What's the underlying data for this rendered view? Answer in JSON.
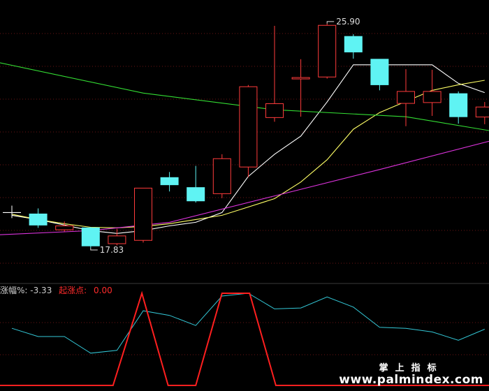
{
  "chart_data": {
    "type": "candlestick",
    "price_axis": {
      "min": 17.0,
      "max": 26.5
    },
    "annotations": {
      "high_label": "25.90",
      "low_label": "17.83"
    },
    "candles": [
      {
        "open": 19.1,
        "close": 19.1,
        "high": 19.35,
        "low": 18.9,
        "dir": "flat"
      },
      {
        "open": 19.05,
        "close": 18.65,
        "high": 19.25,
        "low": 18.55,
        "dir": "down"
      },
      {
        "open": 18.48,
        "close": 18.62,
        "high": 18.78,
        "low": 18.42,
        "dir": "up"
      },
      {
        "open": 18.55,
        "close": 17.9,
        "high": 18.58,
        "low": 17.83,
        "dir": "down"
      },
      {
        "open": 17.98,
        "close": 18.26,
        "high": 18.52,
        "low": 17.92,
        "dir": "up"
      },
      {
        "open": 18.1,
        "close": 19.98,
        "high": 19.98,
        "low": 18.02,
        "dir": "up"
      },
      {
        "open": 20.36,
        "close": 20.1,
        "high": 20.56,
        "low": 19.86,
        "dir": "down"
      },
      {
        "open": 20.0,
        "close": 19.52,
        "high": 20.78,
        "low": 19.46,
        "dir": "down"
      },
      {
        "open": 19.78,
        "close": 21.04,
        "high": 21.2,
        "low": 19.62,
        "dir": "up"
      },
      {
        "open": 20.74,
        "close": 23.63,
        "high": 23.69,
        "low": 20.37,
        "dir": "up"
      },
      {
        "open": 22.52,
        "close": 23.02,
        "high": 25.82,
        "low": 22.37,
        "dir": "up"
      },
      {
        "open": 23.96,
        "close": 23.96,
        "high": 24.62,
        "low": 22.55,
        "dir": "up"
      },
      {
        "open": 23.98,
        "close": 25.84,
        "high": 25.9,
        "low": 23.92,
        "dir": "up"
      },
      {
        "open": 25.44,
        "close": 24.88,
        "high": 25.52,
        "low": 24.64,
        "dir": "down"
      },
      {
        "open": 24.62,
        "close": 23.7,
        "high": 24.62,
        "low": 23.5,
        "dir": "down"
      },
      {
        "open": 23.03,
        "close": 23.46,
        "high": 24.26,
        "low": 22.21,
        "dir": "up"
      },
      {
        "open": 23.06,
        "close": 23.46,
        "high": 24.24,
        "low": 22.58,
        "dir": "up"
      },
      {
        "open": 23.38,
        "close": 22.55,
        "high": 23.46,
        "low": 22.3,
        "dir": "down"
      },
      {
        "open": 22.54,
        "close": 22.9,
        "high": 23.08,
        "low": 22.28,
        "dir": "up"
      }
    ],
    "ma_lines": [
      {
        "color": "#ffffff",
        "points": [
          [
            0,
            19.0
          ],
          [
            1,
            18.85
          ],
          [
            2,
            18.65
          ],
          [
            3,
            18.45
          ],
          [
            4,
            18.35
          ],
          [
            5,
            18.45
          ],
          [
            6,
            18.62
          ],
          [
            7,
            18.75
          ],
          [
            8,
            19.1
          ],
          [
            9,
            20.4
          ],
          [
            10,
            21.2
          ],
          [
            11,
            21.85
          ],
          [
            12,
            23.08
          ],
          [
            13,
            24.42
          ],
          [
            14,
            24.42
          ],
          [
            15,
            24.42
          ],
          [
            16,
            24.42
          ],
          [
            17,
            23.75
          ],
          [
            18,
            23.42
          ]
        ]
      },
      {
        "color": "#ffff66",
        "points": [
          [
            0,
            19.04
          ],
          [
            1,
            18.85
          ],
          [
            2,
            18.7
          ],
          [
            3,
            18.57
          ],
          [
            4,
            18.55
          ],
          [
            5,
            18.6
          ],
          [
            6,
            18.7
          ],
          [
            7,
            18.85
          ],
          [
            8,
            19.0
          ],
          [
            9,
            19.3
          ],
          [
            10,
            19.6
          ],
          [
            11,
            20.2
          ],
          [
            12,
            21.0
          ],
          [
            13,
            22.1
          ],
          [
            14,
            22.7
          ],
          [
            15,
            23.1
          ],
          [
            16,
            23.5
          ],
          [
            17,
            23.7
          ],
          [
            18,
            23.86
          ]
        ]
      },
      {
        "color": "#33dd33",
        "points": [
          [
            -0.5,
            24.5
          ],
          [
            5,
            23.4
          ],
          [
            10,
            22.8
          ],
          [
            15,
            22.55
          ],
          [
            18.5,
            22.0
          ]
        ]
      },
      {
        "color": "#dd33dd",
        "points": [
          [
            -0.5,
            18.3
          ],
          [
            3,
            18.45
          ],
          [
            6,
            18.75
          ],
          [
            10,
            19.7
          ],
          [
            14,
            20.65
          ],
          [
            18.5,
            21.75
          ]
        ]
      }
    ],
    "indicator": {
      "legend_label": "涨幅%:",
      "legend_value": "-3.33",
      "signal_label": "起涨点:",
      "signal_value": "0.00",
      "range": [
        0,
        1
      ],
      "cyan": [
        [
          0,
          0.62
        ],
        [
          1,
          0.53
        ],
        [
          2,
          0.53
        ],
        [
          3,
          0.35
        ],
        [
          4,
          0.38
        ],
        [
          5,
          0.81
        ],
        [
          6,
          0.76
        ],
        [
          7,
          0.65
        ],
        [
          8,
          0.97
        ],
        [
          9,
          1.0
        ],
        [
          10,
          0.83
        ],
        [
          11,
          0.84
        ],
        [
          12,
          0.96
        ],
        [
          13,
          0.85
        ],
        [
          14,
          0.63
        ],
        [
          15,
          0.62
        ],
        [
          16,
          0.58
        ],
        [
          17,
          0.49
        ],
        [
          18,
          0.61
        ]
      ],
      "red": [
        [
          -0.5,
          0
        ],
        [
          3.85,
          0
        ],
        [
          4.95,
          1.0
        ],
        [
          5.95,
          0
        ],
        [
          7.0,
          0
        ],
        [
          8.0,
          1.0
        ],
        [
          9.05,
          1.0
        ],
        [
          10.05,
          0
        ],
        [
          18.5,
          0
        ]
      ]
    }
  },
  "watermark": {
    "cn": "掌上指标",
    "en": "www.palmindex.com"
  }
}
